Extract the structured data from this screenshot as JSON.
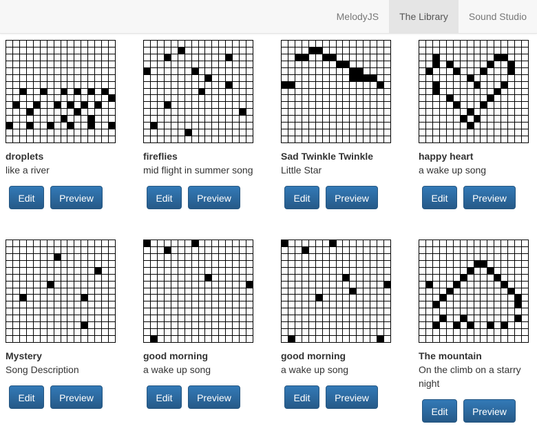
{
  "nav": {
    "items": [
      {
        "label": "MelodyJS",
        "active": false
      },
      {
        "label": "The Library",
        "active": true
      },
      {
        "label": "Sound Studio",
        "active": false
      }
    ]
  },
  "buttons": {
    "edit": "Edit",
    "preview": "Preview"
  },
  "songs": [
    {
      "title": "droplets",
      "description": "like a river",
      "cells": [
        [
          7,
          2
        ],
        [
          7,
          5
        ],
        [
          7,
          8
        ],
        [
          7,
          10
        ],
        [
          7,
          12
        ],
        [
          7,
          14
        ],
        [
          8,
          15
        ],
        [
          9,
          1
        ],
        [
          9,
          4
        ],
        [
          9,
          7
        ],
        [
          9,
          9
        ],
        [
          9,
          11
        ],
        [
          9,
          13
        ],
        [
          10,
          3
        ],
        [
          10,
          10
        ],
        [
          11,
          8
        ],
        [
          11,
          12
        ],
        [
          12,
          0
        ],
        [
          12,
          3
        ],
        [
          12,
          6
        ],
        [
          12,
          9
        ],
        [
          12,
          12
        ],
        [
          12,
          15
        ]
      ]
    },
    {
      "title": "fireflies",
      "description": "mid flight in summer song",
      "cells": [
        [
          1,
          5
        ],
        [
          2,
          3
        ],
        [
          2,
          12
        ],
        [
          4,
          0
        ],
        [
          4,
          7
        ],
        [
          5,
          9
        ],
        [
          6,
          12
        ],
        [
          7,
          8
        ],
        [
          9,
          3
        ],
        [
          10,
          14
        ],
        [
          12,
          1
        ],
        [
          13,
          6
        ]
      ]
    },
    {
      "title": "Sad Twinkle Twinkle",
      "description": "Little Star",
      "cells": [
        [
          1,
          4
        ],
        [
          1,
          5
        ],
        [
          2,
          2
        ],
        [
          2,
          3
        ],
        [
          2,
          6
        ],
        [
          2,
          7
        ],
        [
          3,
          8
        ],
        [
          3,
          9
        ],
        [
          4,
          10
        ],
        [
          4,
          11
        ],
        [
          5,
          10
        ],
        [
          5,
          11
        ],
        [
          5,
          12
        ],
        [
          5,
          13
        ],
        [
          6,
          0
        ],
        [
          6,
          1
        ],
        [
          6,
          14
        ]
      ]
    },
    {
      "title": "happy heart",
      "description": "a wake up song",
      "cells": [
        [
          2,
          2
        ],
        [
          2,
          11
        ],
        [
          2,
          12
        ],
        [
          3,
          2
        ],
        [
          3,
          4
        ],
        [
          3,
          10
        ],
        [
          3,
          13
        ],
        [
          4,
          1
        ],
        [
          4,
          5
        ],
        [
          4,
          9
        ],
        [
          4,
          13
        ],
        [
          5,
          7
        ],
        [
          6,
          2
        ],
        [
          6,
          8
        ],
        [
          6,
          12
        ],
        [
          7,
          2
        ],
        [
          7,
          11
        ],
        [
          8,
          4
        ],
        [
          8,
          10
        ],
        [
          9,
          5
        ],
        [
          9,
          9
        ],
        [
          10,
          7
        ],
        [
          11,
          6
        ],
        [
          11,
          8
        ],
        [
          12,
          7
        ]
      ]
    },
    {
      "title": "Mystery",
      "description": "Song Description",
      "cells": [
        [
          2,
          7
        ],
        [
          4,
          13
        ],
        [
          6,
          6
        ],
        [
          8,
          2
        ],
        [
          8,
          11
        ],
        [
          12,
          11
        ]
      ]
    },
    {
      "title": "good morning",
      "description": "a wake up song",
      "cells": [
        [
          0,
          0
        ],
        [
          0,
          7
        ],
        [
          1,
          3
        ],
        [
          5,
          9
        ],
        [
          6,
          15
        ],
        [
          14,
          1
        ]
      ]
    },
    {
      "title": "good morning",
      "description": "a wake up song",
      "cells": [
        [
          0,
          0
        ],
        [
          0,
          7
        ],
        [
          1,
          3
        ],
        [
          5,
          9
        ],
        [
          6,
          15
        ],
        [
          7,
          10
        ],
        [
          8,
          5
        ],
        [
          14,
          1
        ],
        [
          14,
          14
        ]
      ]
    },
    {
      "title": "The mountain",
      "description": "On the climb on a starry night",
      "cells": [
        [
          3,
          8
        ],
        [
          3,
          9
        ],
        [
          4,
          7
        ],
        [
          4,
          10
        ],
        [
          5,
          6
        ],
        [
          5,
          11
        ],
        [
          6,
          1
        ],
        [
          6,
          5
        ],
        [
          6,
          12
        ],
        [
          7,
          4
        ],
        [
          7,
          13
        ],
        [
          8,
          3
        ],
        [
          8,
          14
        ],
        [
          9,
          2
        ],
        [
          9,
          14
        ],
        [
          11,
          3
        ],
        [
          11,
          6
        ],
        [
          11,
          14
        ],
        [
          12,
          2
        ],
        [
          12,
          5
        ],
        [
          12,
          7
        ],
        [
          12,
          10
        ],
        [
          12,
          12
        ]
      ]
    }
  ]
}
